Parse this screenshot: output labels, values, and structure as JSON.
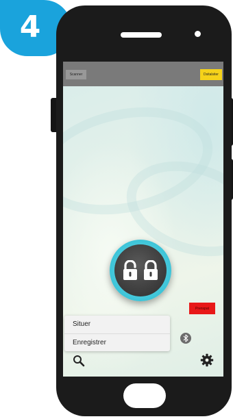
{
  "step": {
    "number": "4"
  },
  "app": {
    "topbar": {
      "scanner_label": "Scanner",
      "connect_label": "Dsitalsiter"
    },
    "lock_button": {
      "icon": "unlocked-padlock-and-locked-padlock"
    },
    "red_button": {
      "label": "Prenspat"
    },
    "menu": {
      "items": [
        {
          "label": "Situer"
        },
        {
          "label": "Enregistrer"
        }
      ]
    },
    "icons": {
      "search": "search-icon",
      "bluetooth": "bluetooth-icon",
      "settings": "gear-icon"
    }
  },
  "colors": {
    "step_badge": "#1aa3dc",
    "phone_body": "#1b1b1b",
    "topbar": "#7a7a7a",
    "connect_button": "#f5d21a",
    "red_button": "#e81818",
    "lock_ring": "#3cc4d8"
  }
}
